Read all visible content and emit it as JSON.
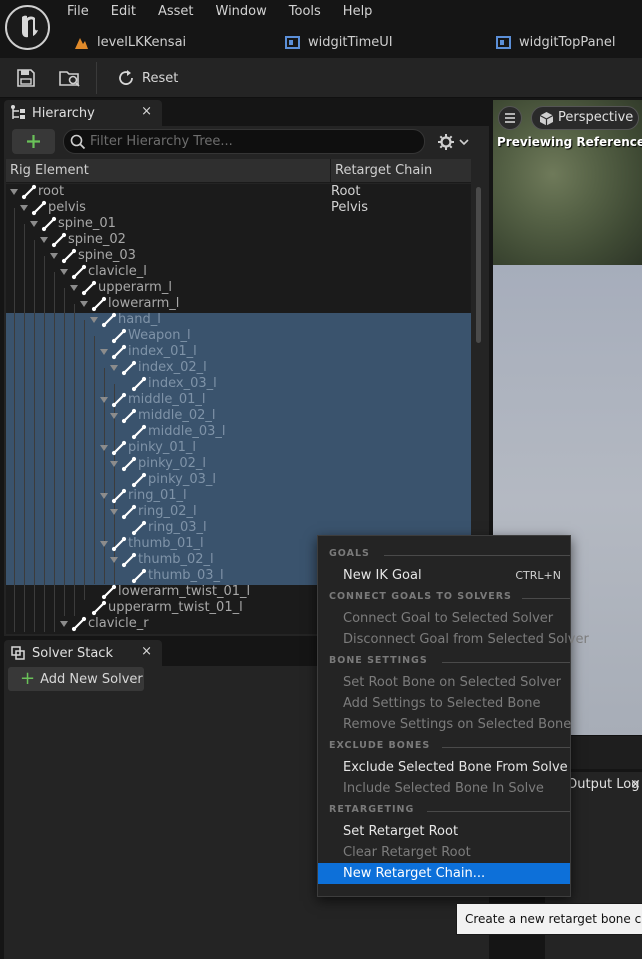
{
  "menu": [
    "File",
    "Edit",
    "Asset",
    "Window",
    "Tools",
    "Help"
  ],
  "doc_tabs": [
    "levelLKKensai",
    "widgitTimeUI",
    "widgitTopPanel"
  ],
  "toolbar": {
    "reset_label": "Reset"
  },
  "hierarchy": {
    "tab_label": "Hierarchy",
    "close": "×",
    "search_placeholder": "Filter Hierarchy Tree...",
    "col_element": "Rig Element",
    "col_chain": "Retarget Chain",
    "rows": [
      {
        "name": "root",
        "depth": 0,
        "chain": "Root",
        "selected": false,
        "expander": true
      },
      {
        "name": "pelvis",
        "depth": 1,
        "chain": "Pelvis",
        "selected": false,
        "expander": true
      },
      {
        "name": "spine_01",
        "depth": 2,
        "chain": "",
        "selected": false,
        "expander": true
      },
      {
        "name": "spine_02",
        "depth": 3,
        "chain": "",
        "selected": false,
        "expander": true
      },
      {
        "name": "spine_03",
        "depth": 4,
        "chain": "",
        "selected": false,
        "expander": true
      },
      {
        "name": "clavicle_l",
        "depth": 5,
        "chain": "",
        "selected": false,
        "expander": true
      },
      {
        "name": "upperarm_l",
        "depth": 6,
        "chain": "",
        "selected": false,
        "expander": true
      },
      {
        "name": "lowerarm_l",
        "depth": 7,
        "chain": "",
        "selected": false,
        "expander": true
      },
      {
        "name": "hand_l",
        "depth": 8,
        "chain": "",
        "selected": true,
        "expander": true
      },
      {
        "name": "Weapon_l",
        "depth": 9,
        "chain": "",
        "selected": true,
        "expander": false
      },
      {
        "name": "index_01_l",
        "depth": 9,
        "chain": "",
        "selected": true,
        "expander": true
      },
      {
        "name": "index_02_l",
        "depth": 10,
        "chain": "",
        "selected": true,
        "expander": true
      },
      {
        "name": "index_03_l",
        "depth": 11,
        "chain": "",
        "selected": true,
        "expander": false
      },
      {
        "name": "middle_01_l",
        "depth": 9,
        "chain": "",
        "selected": true,
        "expander": true
      },
      {
        "name": "middle_02_l",
        "depth": 10,
        "chain": "",
        "selected": true,
        "expander": true
      },
      {
        "name": "middle_03_l",
        "depth": 11,
        "chain": "",
        "selected": true,
        "expander": false
      },
      {
        "name": "pinky_01_l",
        "depth": 9,
        "chain": "",
        "selected": true,
        "expander": true
      },
      {
        "name": "pinky_02_l",
        "depth": 10,
        "chain": "",
        "selected": true,
        "expander": true
      },
      {
        "name": "pinky_03_l",
        "depth": 11,
        "chain": "",
        "selected": true,
        "expander": false
      },
      {
        "name": "ring_01_l",
        "depth": 9,
        "chain": "",
        "selected": true,
        "expander": true
      },
      {
        "name": "ring_02_l",
        "depth": 10,
        "chain": "",
        "selected": true,
        "expander": true
      },
      {
        "name": "ring_03_l",
        "depth": 11,
        "chain": "",
        "selected": true,
        "expander": false
      },
      {
        "name": "thumb_01_l",
        "depth": 9,
        "chain": "",
        "selected": true,
        "expander": true
      },
      {
        "name": "thumb_02_l",
        "depth": 10,
        "chain": "",
        "selected": true,
        "expander": true
      },
      {
        "name": "thumb_03_l",
        "depth": 11,
        "chain": "",
        "selected": true,
        "expander": false
      },
      {
        "name": "lowerarm_twist_01_l",
        "depth": 8,
        "chain": "",
        "selected": false,
        "expander": false
      },
      {
        "name": "upperarm_twist_01_l",
        "depth": 7,
        "chain": "",
        "selected": false,
        "expander": false
      },
      {
        "name": "clavicle_r",
        "depth": 5,
        "chain": "",
        "selected": false,
        "expander": true
      }
    ]
  },
  "solver_stack": {
    "tab_label": "Solver Stack",
    "close": "×",
    "add_label": "Add New Solver"
  },
  "viewport": {
    "perspective": "Perspective",
    "preview_text": "Previewing Reference Pose"
  },
  "output_log": {
    "tab_label": "Output Log",
    "close": "×"
  },
  "context_menu": {
    "sections": [
      {
        "title": "GOALS",
        "items": [
          {
            "label": "New IK Goal",
            "shortcut": "CTRL+N",
            "enabled": true,
            "hover": false
          }
        ]
      },
      {
        "title": "CONNECT GOALS TO SOLVERS",
        "items": [
          {
            "label": "Connect Goal to Selected Solver",
            "shortcut": "",
            "enabled": false,
            "hover": false
          },
          {
            "label": "Disconnect Goal from Selected Solver",
            "shortcut": "",
            "enabled": false,
            "hover": false
          }
        ]
      },
      {
        "title": "BONE SETTINGS",
        "items": [
          {
            "label": "Set Root Bone on Selected Solver",
            "shortcut": "",
            "enabled": false,
            "hover": false
          },
          {
            "label": "Add Settings to Selected Bone",
            "shortcut": "",
            "enabled": false,
            "hover": false
          },
          {
            "label": "Remove Settings on Selected Bone",
            "shortcut": "",
            "enabled": false,
            "hover": false
          }
        ]
      },
      {
        "title": "EXCLUDE BONES",
        "items": [
          {
            "label": "Exclude Selected Bone From Solve",
            "shortcut": "",
            "enabled": true,
            "hover": false
          },
          {
            "label": "Include Selected Bone In Solve",
            "shortcut": "",
            "enabled": false,
            "hover": false
          }
        ]
      },
      {
        "title": "RETARGETING",
        "items": [
          {
            "label": "Set Retarget Root",
            "shortcut": "",
            "enabled": true,
            "hover": false
          },
          {
            "label": "Clear Retarget Root",
            "shortcut": "",
            "enabled": false,
            "hover": false
          },
          {
            "label": "New Retarget Chain...",
            "shortcut": "",
            "enabled": true,
            "hover": true
          }
        ]
      }
    ]
  },
  "tooltip": "Create a new retarget bone chain",
  "colors": {
    "accent": "#0d70d9",
    "selection": "#3a536d",
    "add_green": "#6ac259"
  }
}
